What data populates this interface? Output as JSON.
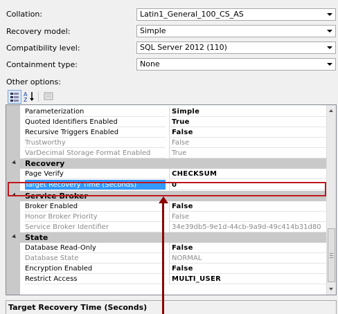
{
  "fields": {
    "collation": {
      "label": "Collation:",
      "value": "Latin1_General_100_CS_AS"
    },
    "recovery_model": {
      "label": "Recovery model:",
      "value": "Simple"
    },
    "compatibility_level": {
      "label": "Compatibility level:",
      "value": "SQL Server 2012 (110)"
    },
    "containment_type": {
      "label": "Containment type:",
      "value": "None"
    }
  },
  "other_options_label": "Other options:",
  "toolbar": {
    "categorized_icon": "categorized-grid-icon",
    "alphabetical_icon": "sort-az-icon",
    "property_pages_icon": "property-pages-icon"
  },
  "grid": {
    "rows": [
      {
        "name": "Parameterization",
        "value": "Simple"
      },
      {
        "name": "Quoted Identifiers Enabled",
        "value": "True"
      },
      {
        "name": "Recursive Triggers Enabled",
        "value": "False"
      },
      {
        "name": "Trustworthy",
        "value": "False"
      },
      {
        "name": "VarDecimal Storage Format Enabled",
        "value": "True"
      },
      {
        "name": "Recovery",
        "value": ""
      },
      {
        "name": "Page Verify",
        "value": "CHECKSUM"
      },
      {
        "name": "Target Recovery Time (Seconds)",
        "value": "0"
      },
      {
        "name": "Service Broker",
        "value": ""
      },
      {
        "name": "Broker Enabled",
        "value": "False"
      },
      {
        "name": "Honor Broker Priority",
        "value": "False"
      },
      {
        "name": "Service Broker Identifier",
        "value": "34e39db5-9e1d-44cb-9a9d-49c414b31d80"
      },
      {
        "name": "State",
        "value": ""
      },
      {
        "name": "Database Read-Only",
        "value": "False"
      },
      {
        "name": "Database State",
        "value": "NORMAL"
      },
      {
        "name": "Encryption Enabled",
        "value": "False"
      },
      {
        "name": "Restrict Access",
        "value": "MULTI_USER"
      }
    ]
  },
  "description": {
    "title": "Target Recovery Time (Seconds)"
  },
  "colors": {
    "selection": "#3399ff",
    "highlight_box": "#c0161c",
    "arrow": "#8b0000"
  }
}
